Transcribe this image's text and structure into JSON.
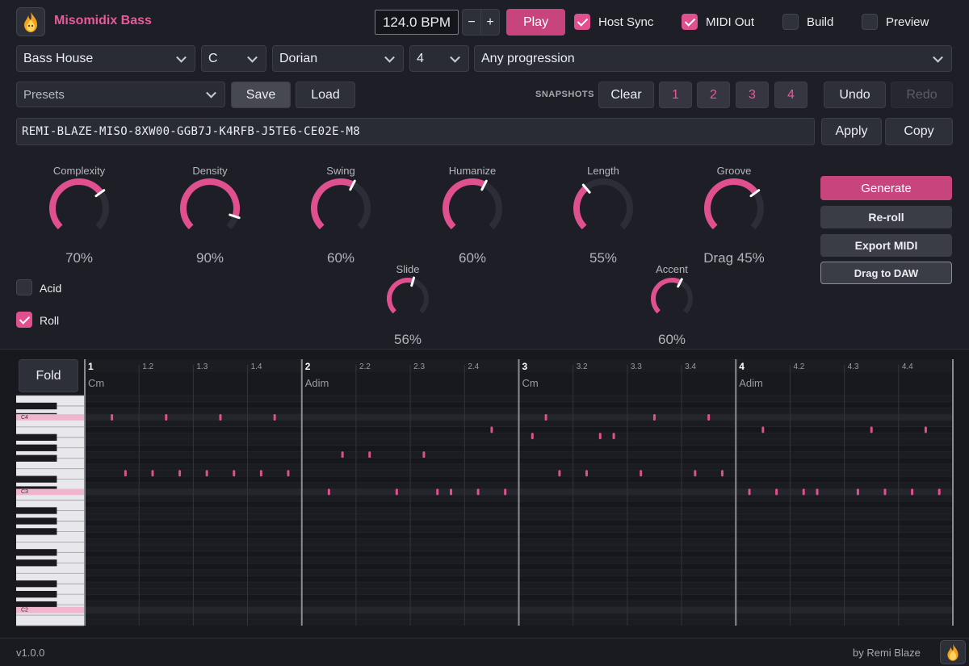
{
  "header": {
    "title": "Misomidix Bass",
    "bpm": "124.0 BPM",
    "bpm_minus": "−",
    "bpm_plus": "+",
    "play_label": "Play",
    "host_sync": {
      "label": "Host Sync",
      "checked": true
    },
    "midi_out": {
      "label": "MIDI Out",
      "checked": true
    },
    "build": {
      "label": "Build",
      "checked": false
    },
    "preview": {
      "label": "Preview",
      "checked": false
    }
  },
  "selectors": {
    "style": "Bass House",
    "key": "C",
    "mode": "Dorian",
    "bars": "4",
    "progression": "Any progression"
  },
  "presets": {
    "placeholder": "Presets",
    "save_label": "Save",
    "load_label": "Load",
    "snapshots_label": "SNAPSHOTS",
    "clear_label": "Clear",
    "snapshots": [
      "1",
      "2",
      "3",
      "4"
    ],
    "undo_label": "Undo",
    "redo_label": "Redo"
  },
  "code": {
    "value": "REMI-BLAZE-MISO-8XW00-GGB7J-K4RFB-J5TE6-CE02E-M8",
    "apply_label": "Apply",
    "copy_label": "Copy"
  },
  "knobs": [
    {
      "name": "complexity",
      "label": "Complexity",
      "value_text": "70%",
      "value": 0.7
    },
    {
      "name": "density",
      "label": "Density",
      "value_text": "90%",
      "value": 0.9
    },
    {
      "name": "swing",
      "label": "Swing",
      "value_text": "60%",
      "value": 0.6
    },
    {
      "name": "humanize",
      "label": "Humanize",
      "value_text": "60%",
      "value": 0.6
    },
    {
      "name": "length",
      "label": "Length",
      "value_text": "55%",
      "value": 0.35
    },
    {
      "name": "groove",
      "label": "Groove",
      "value_text": "Drag 45%",
      "value": 0.7
    },
    {
      "name": "slide",
      "label": "Slide",
      "value_text": "56%",
      "value": 0.56
    },
    {
      "name": "accent",
      "label": "Accent",
      "value_text": "60%",
      "value": 0.6
    }
  ],
  "toggles": {
    "acid": {
      "label": "Acid",
      "checked": false
    },
    "roll": {
      "label": "Roll",
      "checked": true
    }
  },
  "actions": {
    "generate": "Generate",
    "reroll": "Re-roll",
    "export": "Export MIDI",
    "drag": "Drag to DAW"
  },
  "piano_roll": {
    "fold_label": "Fold",
    "bar_labels": [
      "1",
      "2",
      "3",
      "4"
    ],
    "beat_labels": [
      "1.2",
      "1.3",
      "1.4",
      "2.2",
      "2.3",
      "2.4",
      "3.2",
      "3.3",
      "3.4",
      "4.2",
      "4.3",
      "4.4"
    ],
    "chords": [
      "Cm",
      "Adim",
      "Cm",
      "Adim"
    ],
    "key_labels": [
      "C4",
      "C3",
      "C2"
    ],
    "notes": [
      {
        "row": 3,
        "beat": 0.5
      },
      {
        "row": 3,
        "beat": 1.5
      },
      {
        "row": 3,
        "beat": 2.5
      },
      {
        "row": 3,
        "beat": 3.5
      },
      {
        "row": 12,
        "beat": 0.75
      },
      {
        "row": 12,
        "beat": 1.25
      },
      {
        "row": 12,
        "beat": 1.75
      },
      {
        "row": 12,
        "beat": 2.25
      },
      {
        "row": 12,
        "beat": 2.75
      },
      {
        "row": 12,
        "beat": 3.25
      },
      {
        "row": 12,
        "beat": 3.75
      },
      {
        "row": 15,
        "beat": 4.5
      },
      {
        "row": 9,
        "beat": 4.75
      },
      {
        "row": 9,
        "beat": 5.25
      },
      {
        "row": 15,
        "beat": 5.75
      },
      {
        "row": 9,
        "beat": 6.25
      },
      {
        "row": 15,
        "beat": 6.5
      },
      {
        "row": 15,
        "beat": 6.75
      },
      {
        "row": 15,
        "beat": 7.25
      },
      {
        "row": 5,
        "beat": 7.5
      },
      {
        "row": 15,
        "beat": 7.75
      },
      {
        "row": 6,
        "beat": 8.25
      },
      {
        "row": 3,
        "beat": 8.5
      },
      {
        "row": 12,
        "beat": 8.75
      },
      {
        "row": 12,
        "beat": 9.25
      },
      {
        "row": 6,
        "beat": 9.5
      },
      {
        "row": 6,
        "beat": 9.75
      },
      {
        "row": 12,
        "beat": 10.25
      },
      {
        "row": 3,
        "beat": 10.5
      },
      {
        "row": 12,
        "beat": 11.25
      },
      {
        "row": 3,
        "beat": 11.5
      },
      {
        "row": 12,
        "beat": 11.75
      },
      {
        "row": 15,
        "beat": 12.25
      },
      {
        "row": 5,
        "beat": 12.5
      },
      {
        "row": 15,
        "beat": 12.75
      },
      {
        "row": 15,
        "beat": 13.25
      },
      {
        "row": 15,
        "beat": 13.5
      },
      {
        "row": 15,
        "beat": 14.25
      },
      {
        "row": 5,
        "beat": 14.5
      },
      {
        "row": 15,
        "beat": 14.75
      },
      {
        "row": 15,
        "beat": 15.25
      },
      {
        "row": 5,
        "beat": 15.5
      },
      {
        "row": 15,
        "beat": 15.75
      }
    ]
  },
  "footer": {
    "version": "v1.0.0",
    "credit": "by Remi Blaze"
  },
  "colors": {
    "accent": "#e0508e",
    "accent_dark": "#c8447d",
    "panel": "#1e1f26"
  }
}
